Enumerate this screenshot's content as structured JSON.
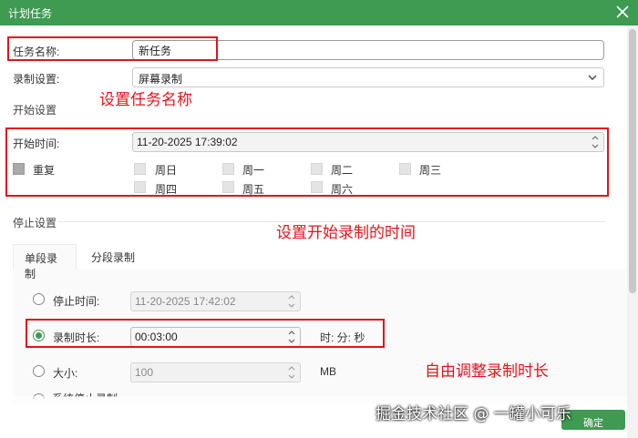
{
  "window": {
    "title": "计划任务"
  },
  "task": {
    "name_label": "任务名称:",
    "name_value": "新任务"
  },
  "record_setting": {
    "label": "录制设置:",
    "value": "屏幕录制"
  },
  "start": {
    "section": "开始设置",
    "time_label": "开始时间:",
    "time_value": "11-20-2025 17:39:02",
    "repeat_label": "重复",
    "days": [
      "周日",
      "周一",
      "周二",
      "周三",
      "周四",
      "周五",
      "周六"
    ]
  },
  "stop": {
    "section": "停止设置",
    "tabs": [
      "单段录制",
      "分段录制"
    ],
    "stop_time_label": "停止时间:",
    "stop_time_value": "11-20-2025 17:42:02",
    "duration_label": "录制时长:",
    "duration_value": "00:03:00",
    "duration_unit": "时: 分: 秒",
    "size_label": "大小:",
    "size_value": "100",
    "size_unit": "MB",
    "clipped_label": "系统停止录制"
  },
  "annotations": {
    "name": "设置任务名称",
    "start": "设置开始录制的时间",
    "duration": "自由调整录制时长"
  },
  "watermark": "掘金技术社区 @ 一罐小可乐",
  "ok_button": "确定",
  "colors": {
    "titlebar": "#3f9a52",
    "annotation": "#e0141e",
    "accent": "#3f9a52"
  }
}
